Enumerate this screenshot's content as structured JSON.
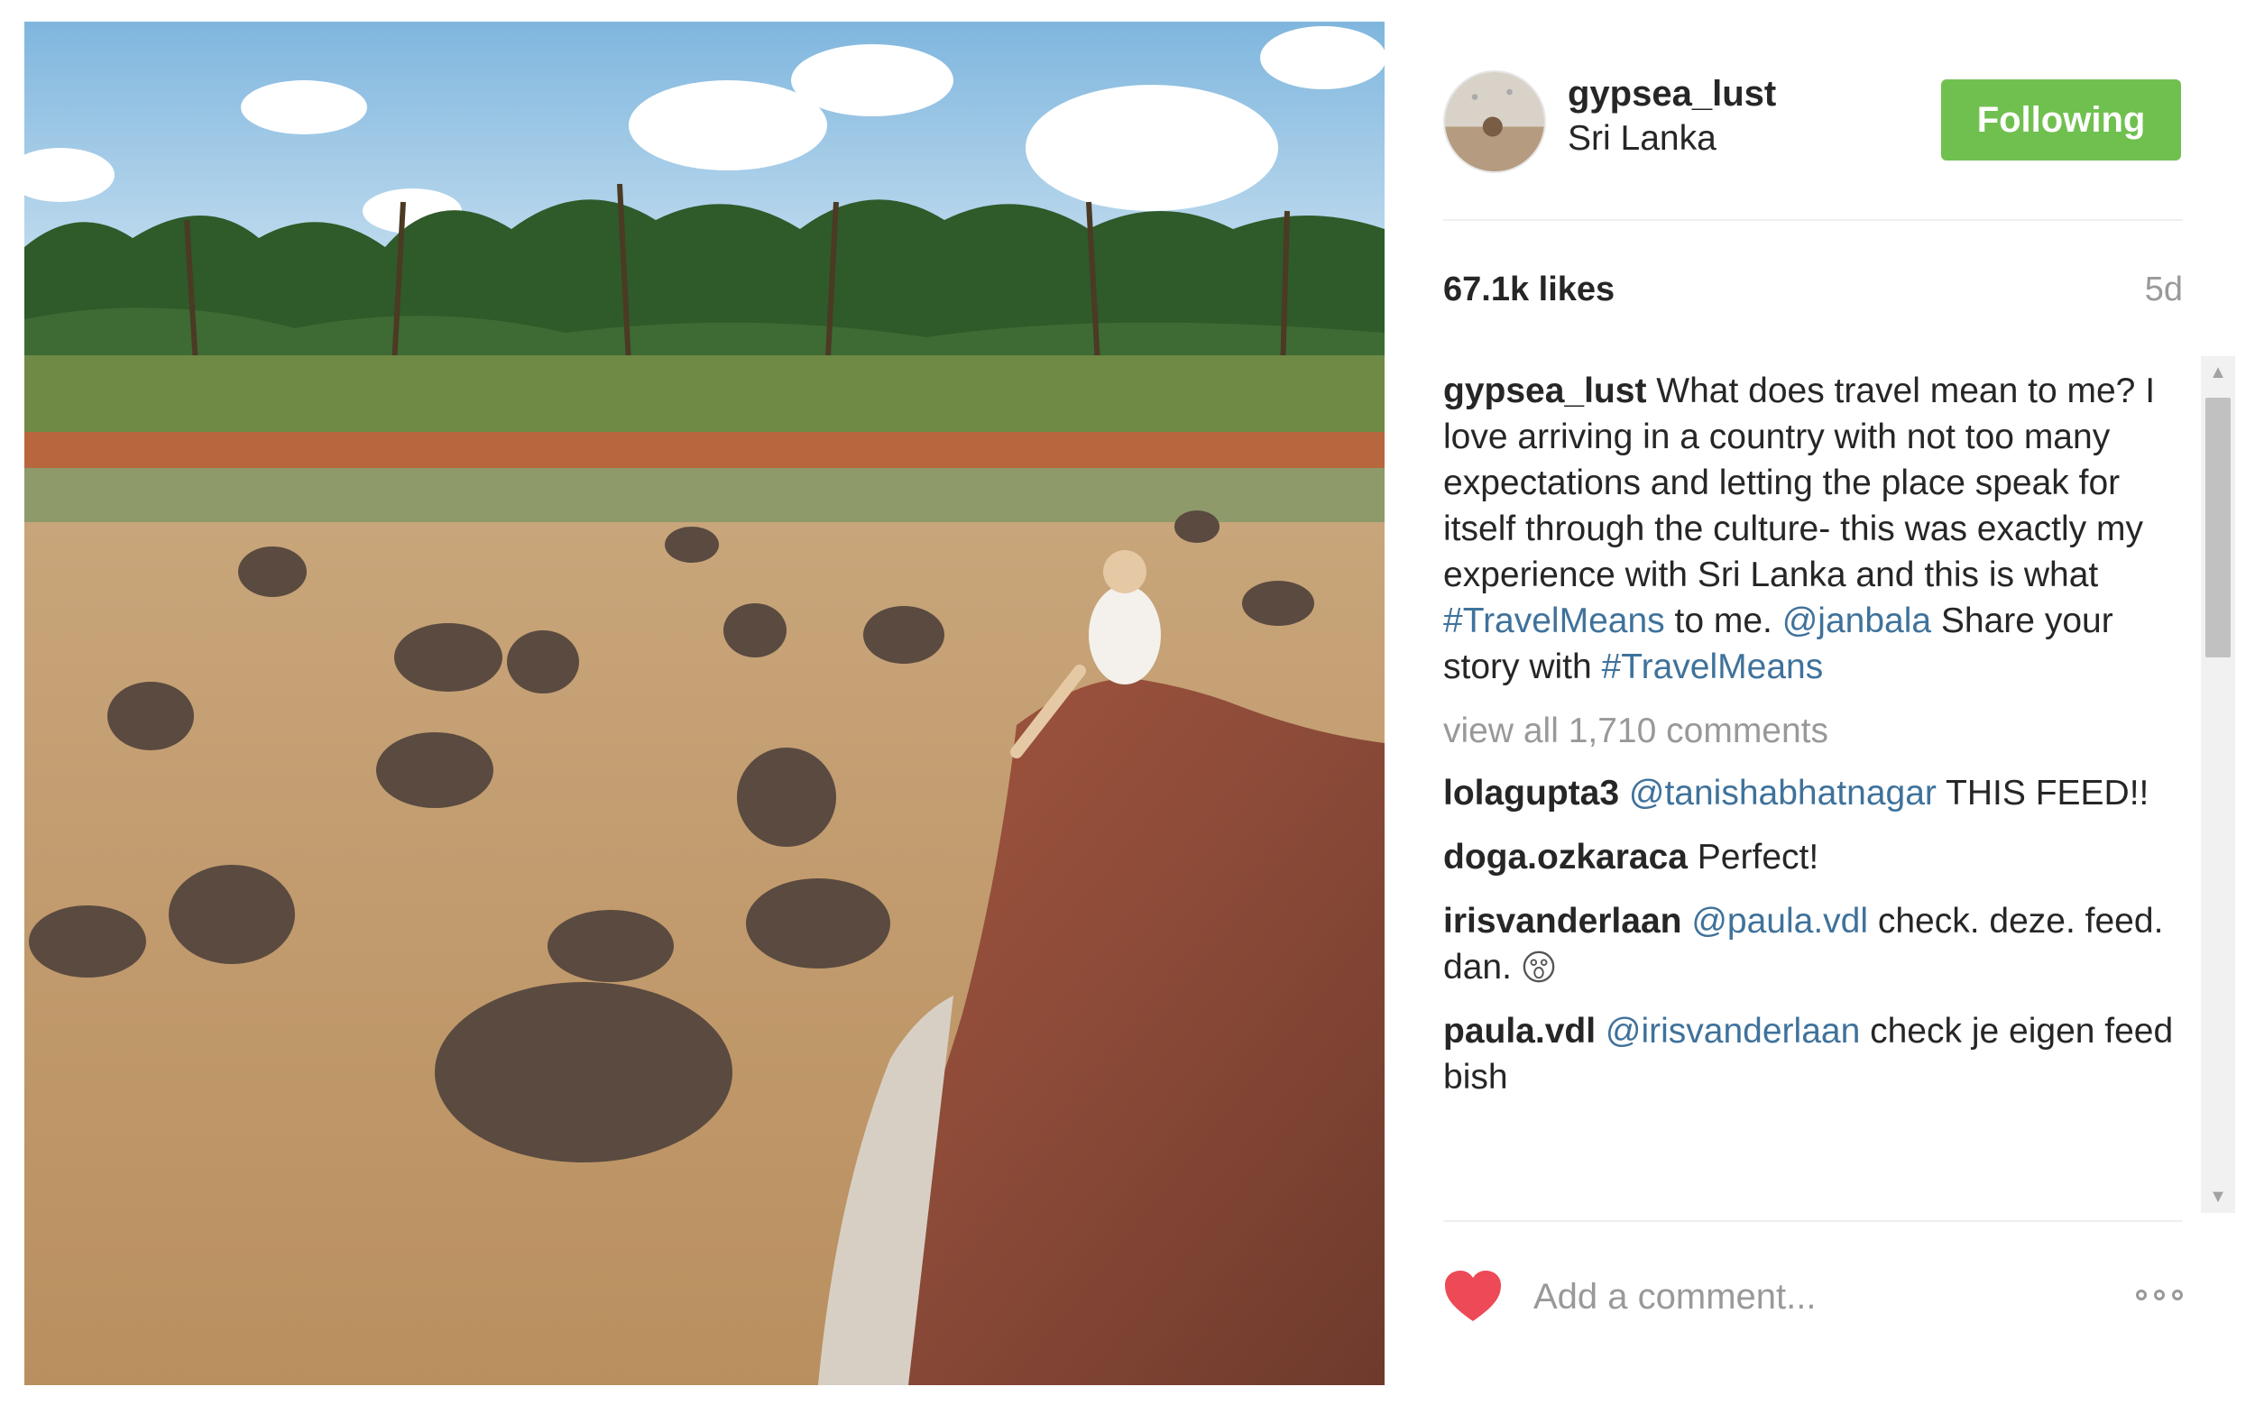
{
  "post": {
    "photo_description_icon": "photo-icon"
  },
  "header": {
    "username": "gypsea_lust",
    "location": "Sri Lanka",
    "follow_label": "Following",
    "follow_color": "#70c050"
  },
  "stats": {
    "likes": "67.1k likes",
    "age": "5d"
  },
  "caption": {
    "user": "gypsea_lust",
    "text_1": " What does travel mean to me? I love arriving in a country with not too many expectations and letting the place speak for itself through the culture- this was exactly my experience with Sri Lanka and this is what ",
    "hashtag_1": "#TravelMeans",
    "text_2": " to me. ",
    "mention": "@janbala",
    "text_3": " Share your story with ",
    "hashtag_2": "#TravelMeans"
  },
  "view_all": "view all 1,710 comments",
  "comments": [
    {
      "user": "lolagupta3",
      "mention": "@tanishabhatnagar",
      "text": " THIS FEED!!"
    },
    {
      "user": "doga.ozkaraca",
      "mention": "",
      "text": " Perfect!"
    },
    {
      "user": "irisvanderlaan",
      "mention": "@paula.vdl",
      "text": " check. deze. feed. dan. "
    },
    {
      "user": "paula.vdl",
      "mention": "@irisvanderlaan",
      "text": " check je eigen feed bish"
    }
  ],
  "footer": {
    "comment_placeholder": "Add a comment...",
    "heart_color": "#ed4956",
    "like_icon": "heart-icon",
    "more_icon": "more-options-icon"
  },
  "colors": {
    "link": "#3f729b",
    "muted": "#999999",
    "text": "#262626"
  }
}
